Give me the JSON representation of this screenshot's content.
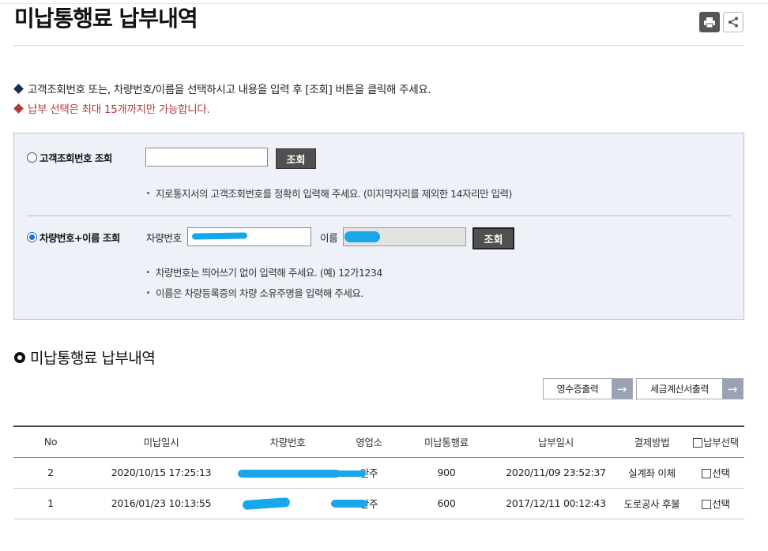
{
  "page": {
    "title": "미납통행료 납부내역"
  },
  "notices": [
    "고객조회번호 또는, 차량번호/이름을 선택하시고 내용을 입력 후 [조회] 버튼을 클릭해 주세요.",
    "납부 선택은 최대 15개까지만 가능합니다."
  ],
  "search": {
    "option1": {
      "label": "고객조회번호 조회",
      "checked": false,
      "input_value": "",
      "button": "조회",
      "hint": "지로통지서의 고객조회번호를 정확히 입력해 주세요. (미지막자리를 제외한 14자리만 입력)"
    },
    "option2": {
      "label": "차량번호+이름 조회",
      "checked": true,
      "car_label": "차량번호",
      "name_label": "이름",
      "button": "조회",
      "hints": [
        "차량번호는 띄어쓰기 없이 입력해 주세요. (예) 12가1234",
        "이름은 차량등록증의 차량 소유주명을 입력해 주세요."
      ]
    }
  },
  "section": {
    "title": "미납통행료 납부내역"
  },
  "actions": {
    "receipt": "영수증출력",
    "tax_invoice": "세금계산서출력"
  },
  "table": {
    "headers": [
      "No",
      "미납일시",
      "차량번호",
      "영업소",
      "미납통행료",
      "납부일시",
      "결제방법",
      "납부선택"
    ],
    "rows": [
      {
        "no": "2",
        "date": "2020/10/15  17:25:13",
        "car": "",
        "office": "안주",
        "amount": "900",
        "paid": "2020/11/09 23:52:37",
        "method": "실계좌 이체",
        "select": "선택"
      },
      {
        "no": "1",
        "date": "2016/01/23  10:13:55",
        "car": "",
        "office": "안주",
        "amount": "600",
        "paid": "2017/12/11 00:12:43",
        "method": "도로공사 후불",
        "select": "선택"
      }
    ]
  },
  "colors": {
    "accent_red": "#b33a3a",
    "query_button": "#505050",
    "search_bg": "#eef2f8",
    "redaction": "#18a7e8"
  }
}
